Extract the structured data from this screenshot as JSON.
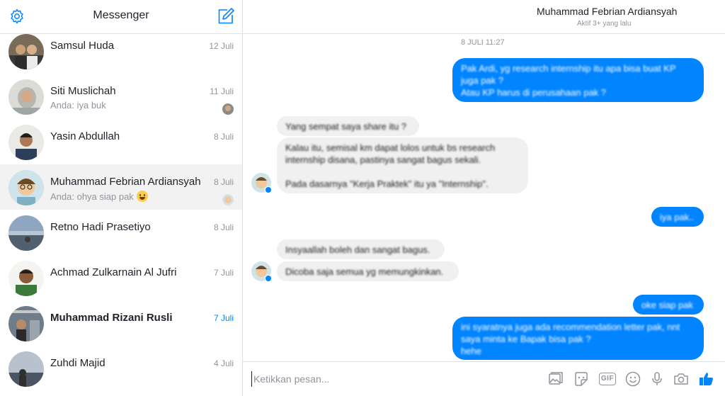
{
  "sidebar": {
    "title": "Messenger",
    "conversations": [
      {
        "name": "Samsul Huda",
        "date": "12 Juli",
        "snippet": "",
        "bold": false,
        "active": false
      },
      {
        "name": "Siti Muslichah",
        "date": "11 Juli",
        "snippet": "Anda: iya buk",
        "bold": false,
        "active": false
      },
      {
        "name": "Yasin Abdullah",
        "date": "8 Juli",
        "snippet": "",
        "bold": false,
        "active": false
      },
      {
        "name": "Muhammad Febrian Ardiansyah",
        "date": "8 Juli",
        "snippet": "Anda: ohya siap pak",
        "bold": false,
        "active": true
      },
      {
        "name": "Retno Hadi Prasetiyo",
        "date": "8 Juli",
        "snippet": "",
        "bold": false,
        "active": false
      },
      {
        "name": "Achmad Zulkarnain Al Jufri",
        "date": "7 Juli",
        "snippet": "",
        "bold": false,
        "active": false
      },
      {
        "name": "Muhammad Rizani Rusli",
        "date": "7 Juli",
        "snippet": "",
        "bold": true,
        "active": false
      },
      {
        "name": "Zuhdi Majid",
        "date": "4 Juli",
        "snippet": "",
        "bold": false,
        "active": false
      }
    ]
  },
  "chat": {
    "contact_name": "Muhammad Febrian Ardiansyah",
    "contact_status": "Aktif 3+ yang lalu",
    "timestamp": "8 JULI 11:27",
    "messages": {
      "m1": [
        "Pak Ardi, yg research internship itu apa bisa buat KP",
        "juga pak ?",
        "Atau KP harus di perusahaan pak ?"
      ],
      "m2": "Yang sempat saya share itu ?",
      "m3": [
        "Kalau itu, semisal km dapat lolos untuk bs research",
        "internship disana, pastinya sangat bagus sekali.",
        "",
        "Pada dasarnya \"Kerja Praktek\" itu ya \"Internship\"."
      ],
      "m4": "iya pak..",
      "m5": "Insyaallah boleh dan sangat bagus.",
      "m6": "Dicoba saja semua yg memungkinkan.",
      "m7": "oke siap pak",
      "m8": [
        "ini syaratnya juga ada recommendation letter pak, nnt",
        "saya minta ke Bapak bisa pak ?",
        "hehe"
      ]
    }
  },
  "composer": {
    "placeholder": "Ketikkan pesan...",
    "gif_label": "GIF",
    "icons": [
      "image-icon",
      "sticker-icon",
      "gif-icon",
      "emoji-icon",
      "microphone-icon",
      "camera-icon",
      "thumbs-up-icon"
    ]
  },
  "colors": {
    "accent": "#0084ff",
    "incoming_bubble": "#f1f0f0",
    "active_row": "#f2f2f2",
    "muted_text": "#90949c"
  }
}
